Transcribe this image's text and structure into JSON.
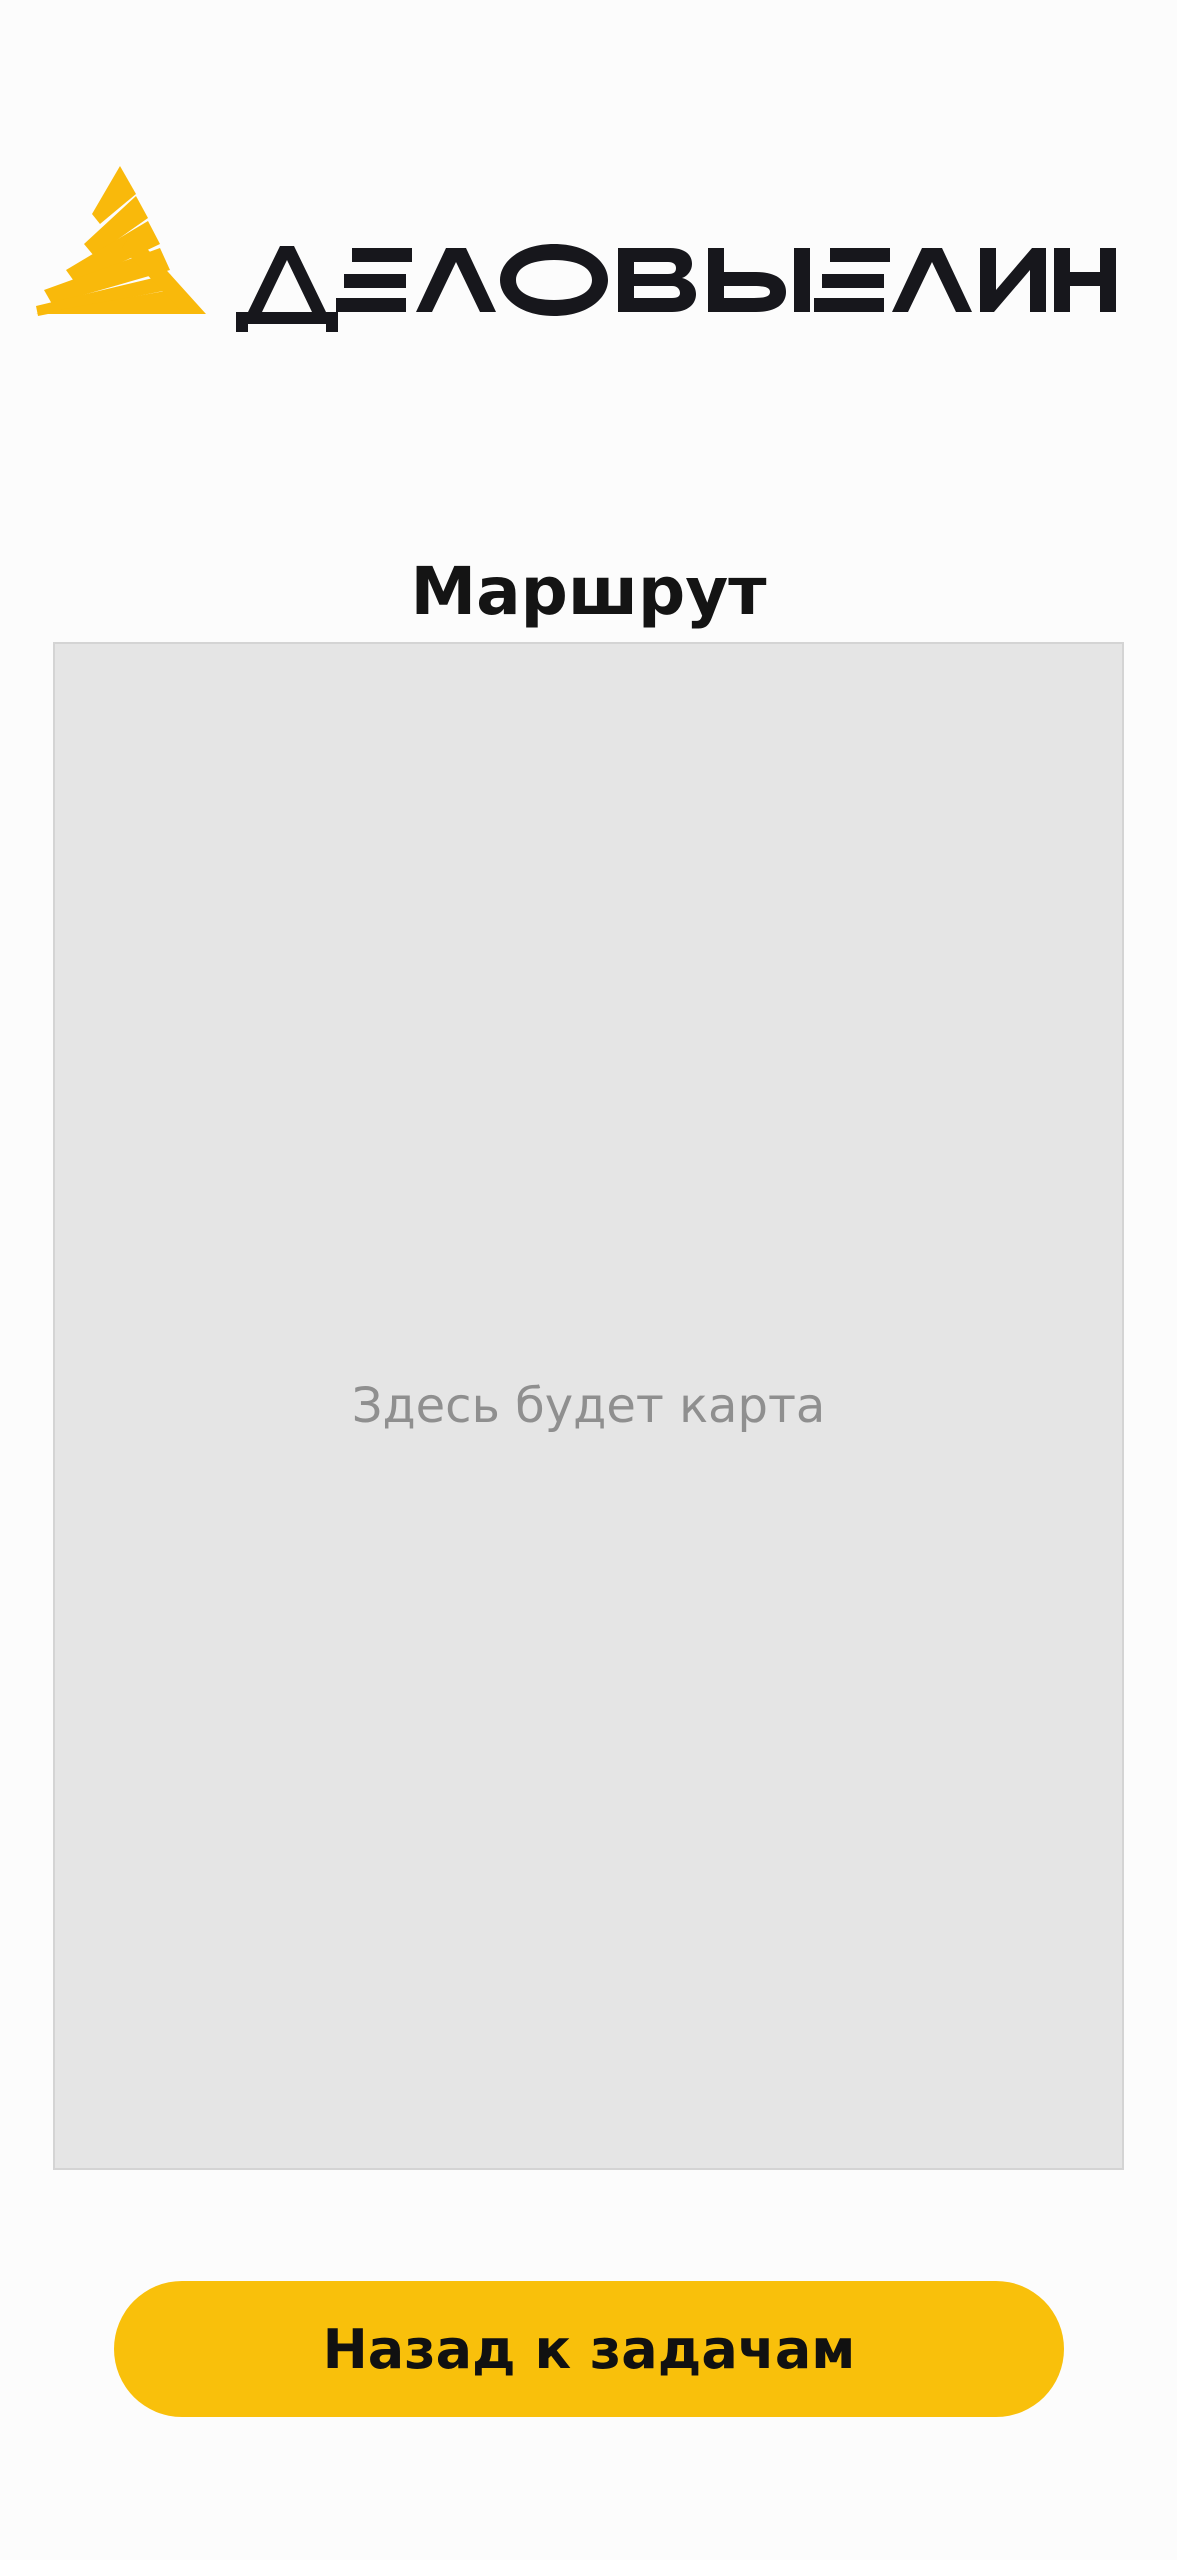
{
  "brand": {
    "name": "ДЕЛОВЫЕ ЛИНИИ",
    "logo_icon": "triangle-sunburst-icon",
    "accent_color": "#f9b90b",
    "text_color": "#17171c"
  },
  "header": {
    "title": "Маршрут"
  },
  "map": {
    "placeholder": "Здесь будет карта",
    "background_color": "#e5e5e5"
  },
  "actions": {
    "back_label": "Назад к задачам",
    "button_color": "#f9c00b"
  }
}
